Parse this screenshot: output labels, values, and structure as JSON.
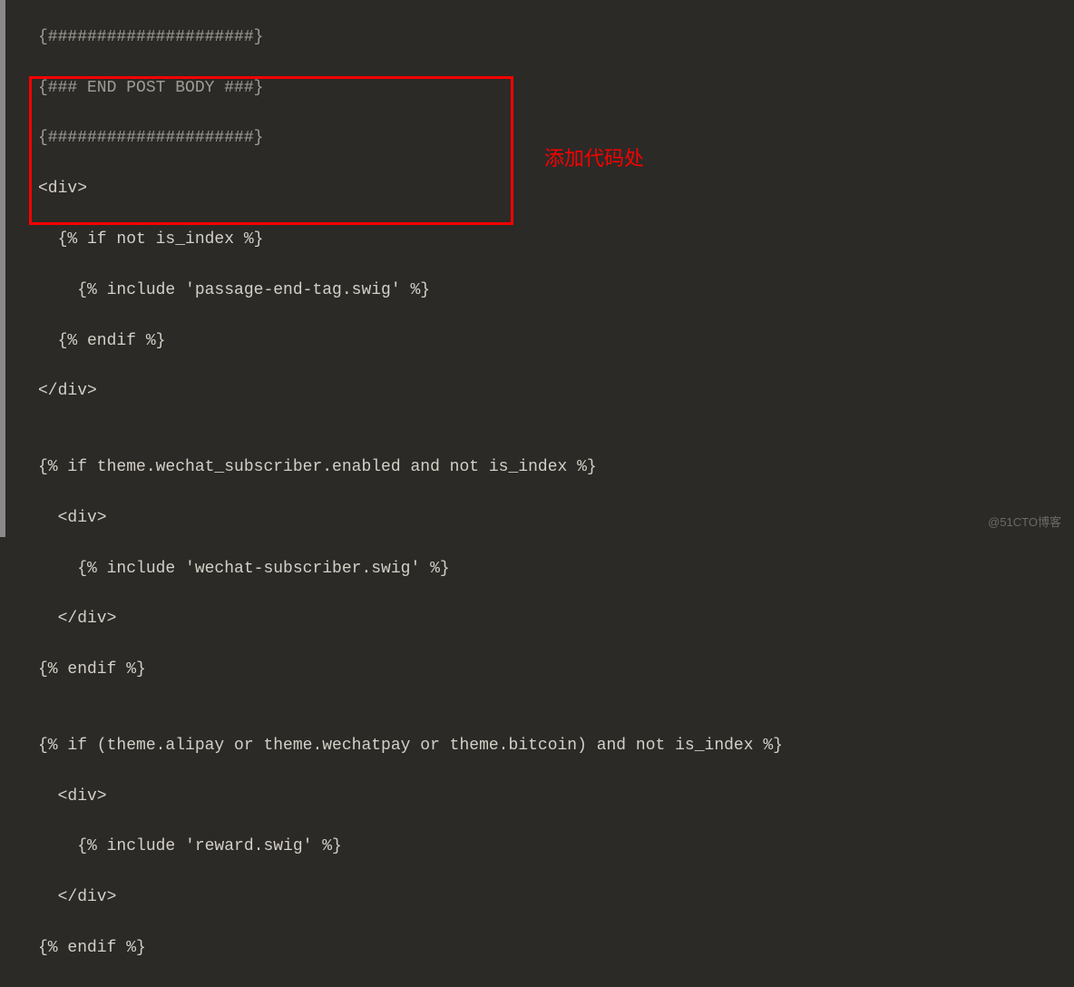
{
  "code": {
    "lines": [
      "{#####################}",
      "{### END POST BODY ###}",
      "{#####################}",
      "<div>",
      "  {% if not is_index %}",
      "    {% include 'passage-end-tag.swig' %}",
      "  {% endif %}",
      "</div>",
      "",
      "{% if theme.wechat_subscriber.enabled and not is_index %}",
      "  <div>",
      "    {% include 'wechat-subscriber.swig' %}",
      "  </div>",
      "{% endif %}",
      "",
      "{% if (theme.alipay or theme.wechatpay or theme.bitcoin) and not is_index %}",
      "  <div>",
      "    {% include 'reward.swig' %}",
      "  </div>",
      "{% endif %}"
    ]
  },
  "annotation": {
    "label": "添加代码处"
  },
  "watermark": "@51CTO博客"
}
